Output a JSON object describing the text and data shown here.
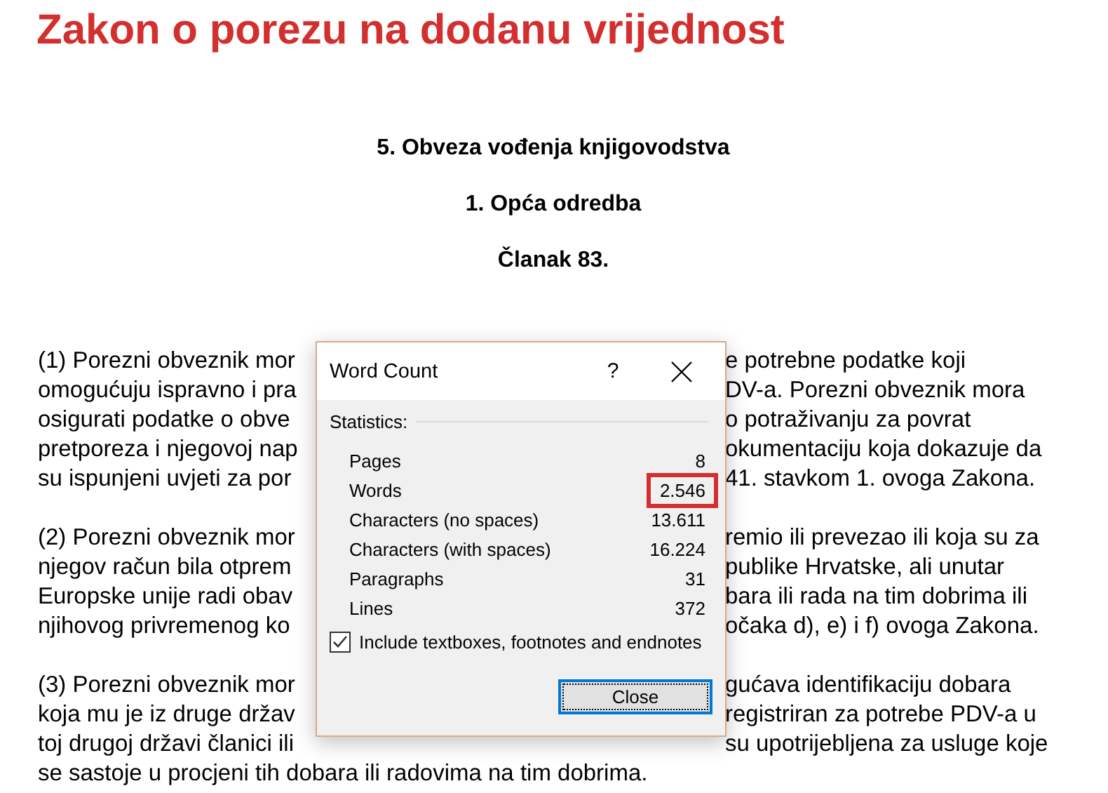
{
  "document": {
    "title": "Zakon o porezu na dodanu vrijednost",
    "headings": [
      "5. Obveza vođenja knjigovodstva",
      "1. Opća odredba",
      "Članak 83."
    ],
    "paragraphs": [
      {
        "lines": [
          {
            "left": "(1) Porezni obveznik mor",
            "right": "e potrebne podatke koji"
          },
          {
            "left": "omogućuju ispravno i pra",
            "right": "DV-a. Porezni obveznik mora"
          },
          {
            "left": "osigurati podatke o obve",
            "right": "o potraživanju za povrat"
          },
          {
            "left": "pretporeza i njegovoj nap",
            "right": "okumentaciju koja dokazuje da"
          },
          {
            "left": "su ispunjeni uvjeti za por",
            "right": "41. stavkom 1. ovoga Zakona."
          }
        ]
      },
      {
        "lines": [
          {
            "left": "(2) Porezni obveznik mor",
            "right": "remio ili prevezao ili koja su za"
          },
          {
            "left": "njegov račun bila otprem",
            "right": "publike Hrvatske, ali unutar"
          },
          {
            "left": "Europske unije radi obav",
            "right": "bara ili rada na tim dobrima ili"
          },
          {
            "left": "njihovog privremenog ko",
            "right": "očaka d), e) i f) ovoga Zakona."
          }
        ]
      },
      {
        "lines": [
          {
            "left": "(3) Porezni obveznik mor",
            "right": "gućava identifikaciju dobara"
          },
          {
            "left": "koja mu je iz druge držav",
            "right": "registriran za potrebe PDV-a u"
          },
          {
            "left": "toj drugoj državi članici ili",
            "right": "su upotrijebljena za usluge koje"
          },
          {
            "full": "se sastoje u procjeni tih dobara ili radovima na tim dobrima."
          }
        ]
      }
    ]
  },
  "dialog": {
    "title": "Word Count",
    "help": "?",
    "group_label": "Statistics:",
    "stats": [
      {
        "label": "Pages",
        "value": "8",
        "highlighted": false
      },
      {
        "label": "Words",
        "value": "2.546",
        "highlighted": true
      },
      {
        "label": "Characters (no spaces)",
        "value": "13.611",
        "highlighted": false
      },
      {
        "label": "Characters (with spaces)",
        "value": "16.224",
        "highlighted": false
      },
      {
        "label": "Paragraphs",
        "value": "31",
        "highlighted": false
      },
      {
        "label": "Lines",
        "value": "372",
        "highlighted": false
      }
    ],
    "include_checkbox": {
      "label": "Include textboxes, footnotes and endnotes",
      "checked": true
    },
    "buttons": [
      "Close"
    ]
  }
}
